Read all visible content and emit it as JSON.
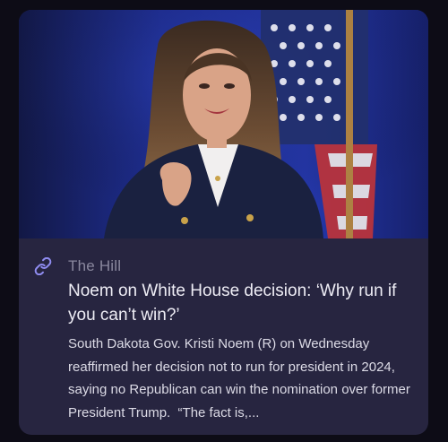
{
  "article": {
    "image_alt": "Photo of Kristi Noem speaking in front of an American flag",
    "source_icon": "link-icon",
    "source": "The Hill",
    "headline": "Noem on White House decision: ‘Why run if you can’t win?’",
    "summary": "South Dakota Gov. Kristi Noem (R) on Wednesday reaffirmed her decision not to run for president in 2024, saying no Republican can win the nomination over former President Trump.  “The fact is,..."
  },
  "colors": {
    "background": "#0d0c16",
    "card": "#272540",
    "accent_icon": "#8f8cf0",
    "source_text": "#8a889e",
    "headline_text": "#eeedf5"
  }
}
